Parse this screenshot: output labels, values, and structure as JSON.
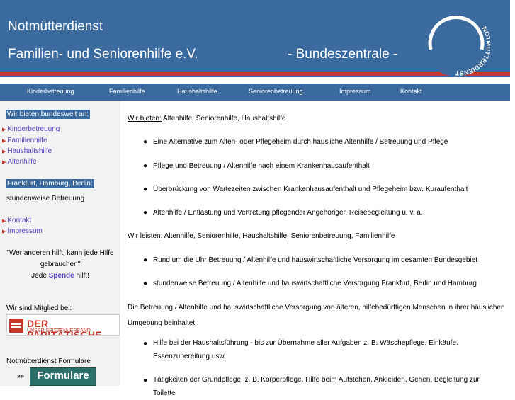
{
  "header": {
    "title1": "Notmütterdienst",
    "title2": "Familien- und Seniorenhilfe e.V.",
    "title3": "- Bundeszentrale -",
    "logo_text": "NOTMÜTTERDIENST"
  },
  "nav": [
    "Kinderbetreuung",
    "Familienhilfe",
    "Haushaltshilfe",
    "Seniorenbetreuung",
    "Impressum",
    "Kontakt"
  ],
  "sidebar": {
    "heading1": "Wir bieten bundesweit an:",
    "links1": [
      "Kinderbetreuung",
      "Familienhilfe",
      "Haushaltshilfe",
      "Altenhilfe"
    ],
    "heading2": "Frankfurt, Hamburg, Berlin:",
    "text2": "stundenweise Betreuung",
    "links2": [
      "Kontakt",
      "Impressum"
    ],
    "quote_line1": "\"Wer anderen hilft, kann jede Hilfe",
    "quote_line2": "gebrauchen\"",
    "quote_pre": "Jede ",
    "quote_link": "Spende",
    "quote_post": " hilft!",
    "member_label": "Wir sind Mitglied bei:",
    "paritaet_title": "DER PARITÄTISCHE",
    "paritaet_sub": "UNSER SPITZENVERBAND",
    "formulare_label": "Notmütterdienst Formulare",
    "formulare_arrows": "»»",
    "formulare_button": "Formulare"
  },
  "main": {
    "offer_label": "Wir bieten:",
    "offer_text": " Altenhilfe, Seniorenhilfe, Haushaltshilfe",
    "offer_items": [
      "Eine Alternative zum Alten- oder Pflegeheim durch häusliche Altenhilfe / Betreuung und Pflege",
      "Pflege und Betreuung / Altenhilfe nach einem Krankenhausaufenthalt",
      "Überbrückung von Wartezeiten zwischen Krankenhausaufenthalt und Pflegeheim bzw. Kuraufenthalt",
      "Altenhilfe / Entlastung und Vertretung pflegender Angehöriger. Reisebegleitung u. v. a."
    ],
    "perform_label": "Wir leisten:",
    "perform_text": " Altenhilfe, Seniorenhilfe, Haushaltshilfe, Seniorenbetreuung, Familienhilfe",
    "perform_items": [
      "Rund um die Uhr Betreuung / Altenhilfe und hauswirtschaftliche Versorgung im gesamten Bundesgebiet",
      "stundenweise Betreuung / Altenhilfe und hauswirtschaftliche Versorgung Frankfurt, Berlin und Hamburg"
    ],
    "paragraph": "Die Betreuung / Altenhilfe und hauswirtschaftliche Versorgung von älteren, hilfebedürftigen Menschen in ihrer häuslichen Umgebung beinhaltet:",
    "care_items": [
      "Hilfe bei der Haushaltsführung - bis zur Übernahme aller Aufgaben z. B. Wäschepflege, Einkäufe, Essenzubereitung usw.",
      "Tätigkeiten der Grundpflege, z. B. Körperpflege, Hilfe beim Aufstehen, Ankleiden, Gehen, Begleitung zur Toilette"
    ],
    "bullet": "●"
  }
}
